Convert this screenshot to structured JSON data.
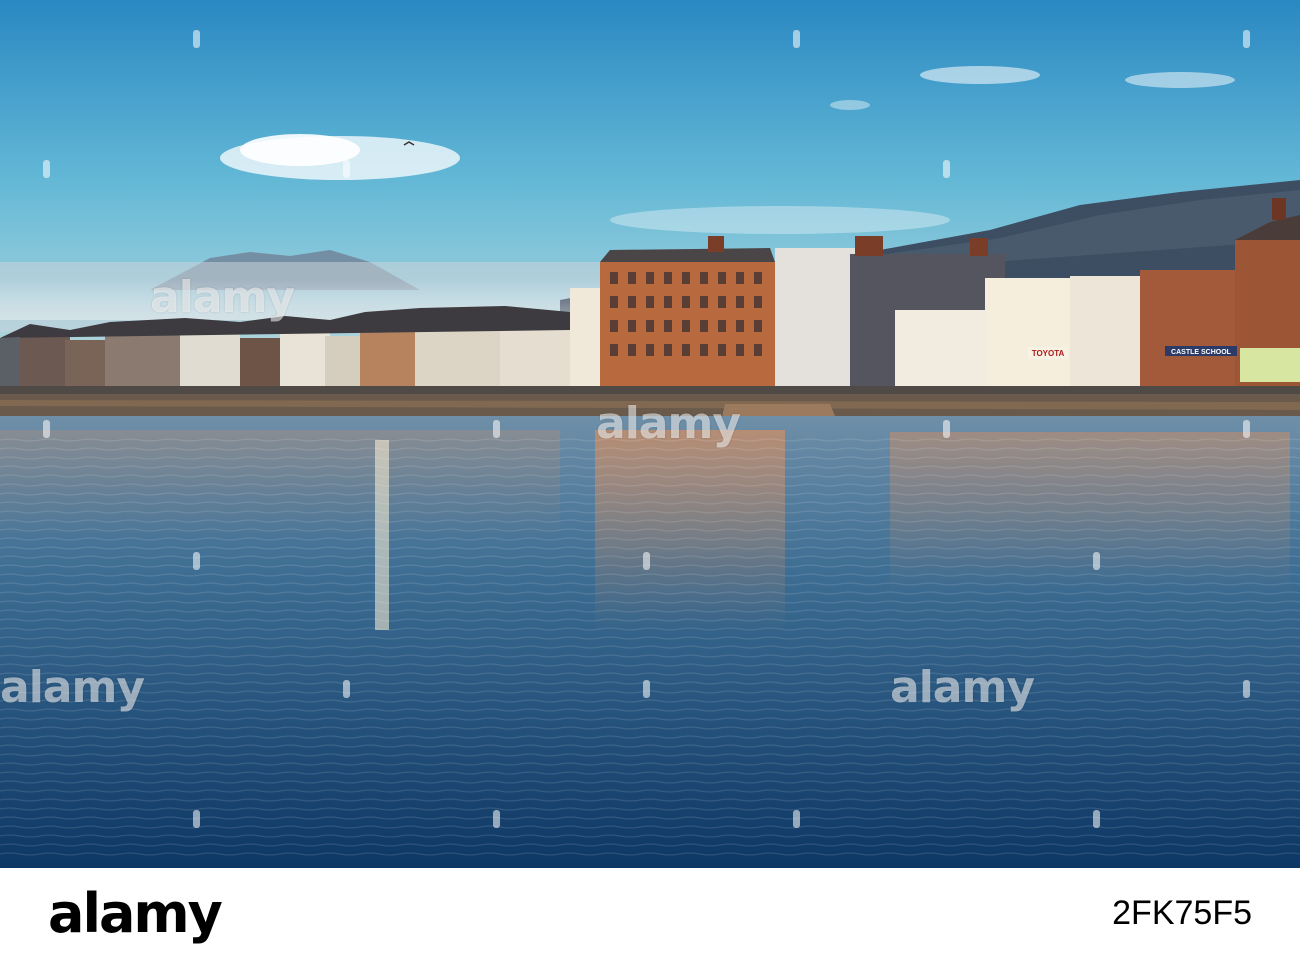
{
  "watermark": {
    "text": "alamy"
  },
  "shopfront_signs": {
    "toyota": "TOYOTA",
    "castle_sign": "CASTLE SCHOOL"
  },
  "footer": {
    "logo": "alamy",
    "image_id": "2FK75F5"
  },
  "colors": {
    "sky_top": "#2e8ec4",
    "sky_mid": "#5fb3d3",
    "water_top": "#5b86a6",
    "water_deep": "#0f3a66",
    "sandstone": "#b86a3e",
    "footer_bg": "#ffffff"
  }
}
